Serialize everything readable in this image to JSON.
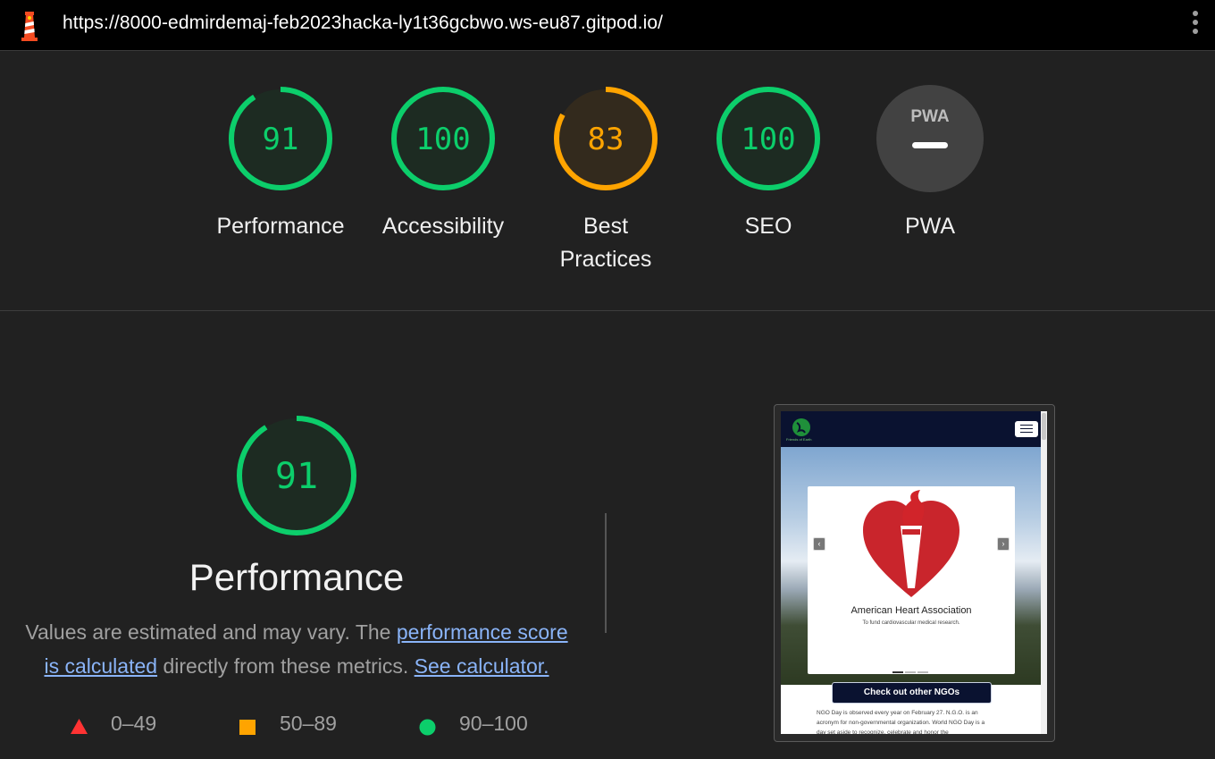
{
  "topbar": {
    "url": "https://8000-edmirdemaj-feb2023hacka-ly1t36gcbwo.ws-eu87.gitpod.io/",
    "logo_icon": "lighthouse-icon",
    "menu_icon": "kebab-menu-icon"
  },
  "categories": [
    {
      "label": "Performance",
      "score": "91",
      "score_value": 91,
      "status": "pass"
    },
    {
      "label": "Accessibility",
      "score": "100",
      "score_value": 100,
      "status": "pass"
    },
    {
      "label": "Best\nPractices",
      "score": "83",
      "score_value": 83,
      "status": "average"
    },
    {
      "label": "SEO",
      "score": "100",
      "score_value": 100,
      "status": "pass"
    },
    {
      "label": "PWA",
      "badge": "PWA",
      "status": "na"
    }
  ],
  "performance": {
    "score": "91",
    "score_value": 91,
    "title": "Performance",
    "desc_prefix": "Values are estimated and may vary. The ",
    "link_score": "performance score is calculated",
    "desc_middle": " directly from these metrics. ",
    "link_calc": "See calculator."
  },
  "legend": [
    {
      "range": "0–49",
      "shape": "triangle-icon",
      "color": "#ff3333"
    },
    {
      "range": "50–89",
      "shape": "square-icon",
      "color": "#ffa400"
    },
    {
      "range": "90–100",
      "shape": "circle-icon",
      "color": "#0cce6b"
    }
  ],
  "colors": {
    "pass": "#0cce6b",
    "average": "#ffa400",
    "fail": "#ff3333",
    "na": "#424242",
    "background": "#212121"
  },
  "thumbnail": {
    "logo_text": "Friends of Earth",
    "card_title": "American Heart Association",
    "card_subtitle": "To fund cardiovascular medical research.",
    "cta": "Check out other NGOs",
    "body_text": "NGO Day is observed every year on February 27. N.G.O. is an acronym for non-governmental organization. World NGO Day is a day set aside to recognize, celebrate and honor the"
  }
}
